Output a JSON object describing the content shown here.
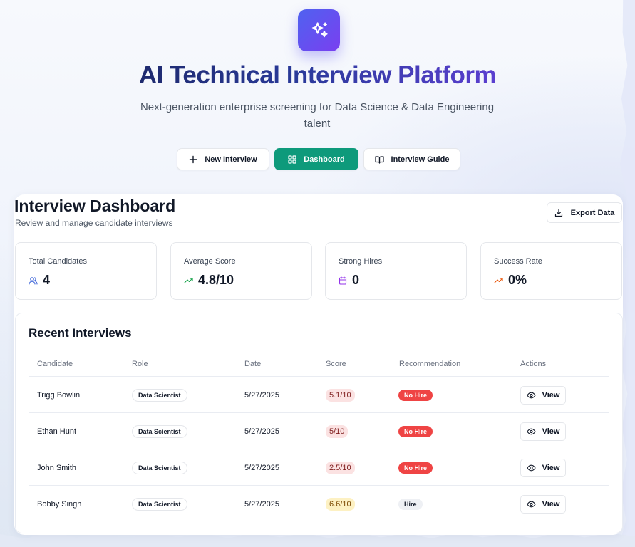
{
  "header": {
    "title": "AI Technical Interview Platform",
    "subtitle": "Next-generation enterprise screening for Data Science & Data Engineering talent",
    "logo_icon": "sparkles-icon"
  },
  "nav": {
    "new_interview": "New Interview",
    "dashboard": "Dashboard",
    "interview_guide": "Interview Guide",
    "active": "Dashboard",
    "accent_color": "#0e9a7b"
  },
  "dashboard": {
    "title": "Interview Dashboard",
    "subtitle": "Review and manage candidate interviews",
    "export_label": "Export Data"
  },
  "stats": [
    {
      "label": "Total Candidates",
      "value": "4",
      "icon": "users-icon",
      "color": "#3b63d8"
    },
    {
      "label": "Average Score",
      "value": "4.8/10",
      "icon": "trending-up-icon",
      "color": "#16a34a"
    },
    {
      "label": "Strong Hires",
      "value": "0",
      "icon": "calendar-icon",
      "color": "#9333ea"
    },
    {
      "label": "Success Rate",
      "value": "0%",
      "icon": "trending-up-icon",
      "color": "#ea580c"
    }
  ],
  "recent": {
    "title": "Recent Interviews",
    "columns": [
      "Candidate",
      "Role",
      "Date",
      "Score",
      "Recommendation",
      "Actions"
    ],
    "rows": [
      {
        "candidate": "Trigg Bowlin",
        "role": "Data Scientist",
        "date": "5/27/2025",
        "score": "5.1/10",
        "recommendation": "No Hire",
        "action": "View"
      },
      {
        "candidate": "Ethan Hunt",
        "role": "Data Scientist",
        "date": "5/27/2025",
        "score": "5/10",
        "recommendation": "No Hire",
        "action": "View"
      },
      {
        "candidate": "John Smith",
        "role": "Data Scientist",
        "date": "5/27/2025",
        "score": "2.5/10",
        "recommendation": "No Hire",
        "action": "View"
      },
      {
        "candidate": "Bobby Singh",
        "role": "Data Scientist",
        "date": "5/27/2025",
        "score": "6.6/10",
        "recommendation": "Hire",
        "action": "View"
      }
    ]
  }
}
